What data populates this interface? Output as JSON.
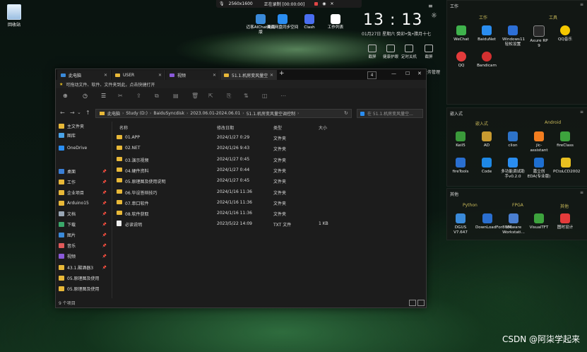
{
  "desktop": {
    "recycle_bin_label": "回收站",
    "recorder": {
      "resolution": "2560x1600",
      "status": "正在录制 [00:00:00]"
    },
    "top_icons": [
      {
        "label": "迈客AIChat桌面版",
        "color": "#3a8ad9"
      },
      {
        "label": "百度网盘同步空间",
        "color": "#2a8df0"
      },
      {
        "label": "Clash",
        "color": "#4a6ef0"
      },
      {
        "label": "工作列表",
        "color": "#ffffff"
      }
    ],
    "clock": {
      "time": "13 : 13",
      "date": "01月27日  星期六  癸卯•兔•腊月十七"
    },
    "clock_tiles": [
      "截屏",
      "健康护眼",
      "定时关机",
      "截屏"
    ],
    "task_manager_label": "任务管理",
    "csdn_watermark": "CSDN @阿柒学起来"
  },
  "panel_work": {
    "title": "工作",
    "section_left": "工作",
    "section_right": "工具",
    "apps": [
      {
        "label": "WeChat",
        "color": "#3fb24c"
      },
      {
        "label": "BaiduNet",
        "color": "#2a8df0"
      },
      {
        "label": "Windows11轻松设置",
        "color": "#2d6fd6"
      },
      {
        "label": "Axure RP 9",
        "color": "#2a2a2a"
      },
      {
        "label": "QQ音乐",
        "color": "#f5c800"
      },
      {
        "label": "QQ",
        "color": "#e33b3b"
      },
      {
        "label": "Bandicam",
        "color": "#d33030"
      }
    ]
  },
  "panel_embedded": {
    "title": "嵌入式",
    "section_left": "嵌入式",
    "section_right": "Android",
    "apps": [
      {
        "label": "Keil5",
        "color": "#3a9a3a"
      },
      {
        "label": "AD",
        "color": "#c89a30"
      },
      {
        "label": "clion",
        "color": "#2d73c9"
      },
      {
        "label": "jlc-assistant",
        "color": "#f27d1f"
      },
      {
        "label": "fireClass",
        "color": "#3da33d"
      },
      {
        "label": "fireTools",
        "color": "#2a6fd0"
      },
      {
        "label": "Code",
        "color": "#1e88e5"
      },
      {
        "label": "多功能调试助手v0.2.0",
        "color": "#2a8df0"
      },
      {
        "label": "嘉立创EDA(专业版)",
        "color": "#1e6fd0"
      },
      {
        "label": "PCtoLCD2002",
        "color": "#e8c020"
      }
    ]
  },
  "panel_other": {
    "title": "其他",
    "section_left": "Python",
    "section_mid": "FPGA",
    "section_right": "其他",
    "apps": [
      {
        "label": "DGUS V7.647",
        "color": "#3a8ad9"
      },
      {
        "label": "DownLoadFor8051",
        "color": "#2a6fd0"
      },
      {
        "label": "VMware Workstati...",
        "color": "#4a7fd0"
      },
      {
        "label": "VisualTFT",
        "color": "#3da33d"
      },
      {
        "label": "图时设计",
        "color": "#e33b3b"
      }
    ]
  },
  "explorer": {
    "tabs": [
      "此电脑",
      "USER",
      "视频",
      "51.1.机房变风量空"
    ],
    "tab_counter": "4",
    "info_text": "可拖动文件、软件、文件夹到此，点击快捷打开",
    "breadcrumb": [
      "此电脑",
      "Study (D:)",
      "BaiduSyncdisk",
      "2023.06.01-2024.06.01",
      "51.1.机房变风量空调控制"
    ],
    "search_placeholder": "在 51.1.机房变风量空...",
    "nav": [
      {
        "label": "主文件夹",
        "color": "#e8b838"
      },
      {
        "label": "图库",
        "color": "#4aa3e8"
      },
      {
        "label": "OneDrive",
        "color": "#2a8df0"
      },
      {
        "label": "桌面",
        "color": "#3a7fd6"
      },
      {
        "label": "工作",
        "color": "#e8b838"
      },
      {
        "label": "企业项目",
        "color": "#e8b838"
      },
      {
        "label": "Arduino15",
        "color": "#e8b838"
      },
      {
        "label": "文档",
        "color": "#9aa7b5"
      },
      {
        "label": "下载",
        "color": "#3aa86a"
      },
      {
        "label": "图片",
        "color": "#3a8ad9"
      },
      {
        "label": "音乐",
        "color": "#e05a5a"
      },
      {
        "label": "视频",
        "color": "#8a5ad9"
      },
      {
        "label": "43.1.酸酒器3",
        "color": "#e8b838"
      },
      {
        "label": "05.原理图及使用",
        "color": "#e8b838"
      },
      {
        "label": "05.原理图及使用",
        "color": "#e8b838"
      }
    ],
    "columns": [
      "名称",
      "修改日期",
      "类型",
      "大小"
    ],
    "rows": [
      {
        "name": "01.APP",
        "date": "2024/1/27 0:29",
        "type": "文件夹",
        "size": "",
        "kind": "folder"
      },
      {
        "name": "02.NET",
        "date": "2024/1/26 9:43",
        "type": "文件夹",
        "size": "",
        "kind": "folder"
      },
      {
        "name": "03.演示视频",
        "date": "2024/1/27 0:45",
        "type": "文件夹",
        "size": "",
        "kind": "folder"
      },
      {
        "name": "04.硬件资料",
        "date": "2024/1/27 0:44",
        "type": "文件夹",
        "size": "",
        "kind": "folder"
      },
      {
        "name": "05.原理图及使用说明",
        "date": "2024/1/27 0:45",
        "type": "文件夹",
        "size": "",
        "kind": "folder"
      },
      {
        "name": "06.毕设答辩技巧",
        "date": "2024/1/16 11:36",
        "type": "文件夹",
        "size": "",
        "kind": "folder"
      },
      {
        "name": "07.串口软件",
        "date": "2024/1/16 11:36",
        "type": "文件夹",
        "size": "",
        "kind": "folder"
      },
      {
        "name": "08.软件获取",
        "date": "2024/1/16 11:36",
        "type": "文件夹",
        "size": "",
        "kind": "folder"
      },
      {
        "name": "必读说明",
        "date": "2023/5/22 14:09",
        "type": "TXT 文件",
        "size": "1 KB",
        "kind": "txt"
      }
    ],
    "status": "9 个项目"
  }
}
